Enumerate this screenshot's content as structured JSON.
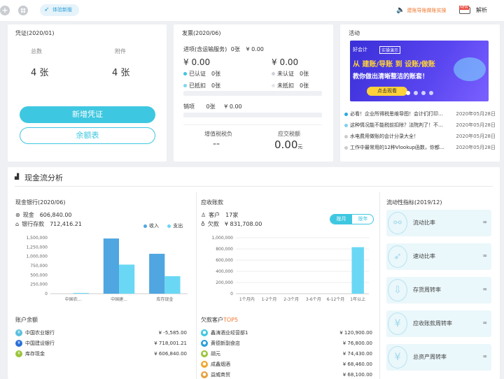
{
  "topbar": {
    "plus_icon": "+",
    "apps_icon": "grid",
    "tab_label": "体验新版",
    "promo_label": "建账导账做账实操",
    "promo_badge": "NEW",
    "analysis_label": "解析"
  },
  "voucher": {
    "title": "凭证(2020/01)",
    "total_label": "总数",
    "attach_label": "附件",
    "total_value": "4 张",
    "attach_value": "4 张",
    "new_btn": "新增凭证",
    "balance_btn": "余额表"
  },
  "invoice": {
    "title": "发票(2020/06)",
    "input_label": "进项(含运输服务)",
    "input_count": "0张",
    "input_amount": "¥ 0.00",
    "left_amount": "¥ 0.00",
    "right_amount": "¥ 0.00",
    "certified": "已认证",
    "certified_count": "0张",
    "uncertified": "未认证",
    "uncertified_count": "0张",
    "deducted": "已抵扣",
    "deducted_count": "0张",
    "undeducted": "未抵扣",
    "undeducted_count": "0张",
    "output_label": "销项",
    "output_count": "0张",
    "output_amount": "¥ 0.00",
    "vat_label": "增值税税负",
    "vat_value": "--",
    "tax_label": "应交税额",
    "tax_value": "0.00",
    "tax_unit": "元"
  },
  "activity": {
    "title": "活动",
    "banner_logo": "好会计",
    "banner_tag": "实操演示",
    "banner_line1": "从 建账/导账 到 设账/做账",
    "banner_line2": "教你做出清晰整洁的账套！",
    "banner_btn": "点击观看",
    "news": [
      {
        "title": "必看！企业所得税思维导图！会计们打印…",
        "date": "2020年05月28日",
        "color": "#2aa7e0"
      },
      {
        "title": "这种情况能不能税前扣除？法院判了！不…",
        "date": "2020年05月28日",
        "color": "#7fd0f0"
      },
      {
        "title": "水电费用做账的会计分录大全！",
        "date": "2020年05月28日",
        "color": "#cccccc"
      },
      {
        "title": "工作中最常用的12种Vlookup函数，你都…",
        "date": "2020年05月28日",
        "color": "#cccccc"
      }
    ]
  },
  "cashflow": {
    "title": "现金流分析",
    "bank_title": "现金银行(2020/06)",
    "cash_label": "现金",
    "cash_value": "606,840.00",
    "bank_label": "银行存款",
    "bank_value": "712,416.21",
    "legend_in": "收入",
    "legend_out": "支出",
    "balance_title": "账户余额",
    "balances": [
      {
        "name": "中国农业银行",
        "amount": "¥ -5,585.00",
        "color": "#5bc0de"
      },
      {
        "name": "中国建设银行",
        "amount": "¥ 718,001.21",
        "color": "#2a6fd8"
      },
      {
        "name": "库存现金",
        "amount": "¥ 606,840.00",
        "color": "#9bc53d"
      }
    ],
    "ar_title": "应收账款",
    "customer_label": "客户",
    "customer_value": "17家",
    "debt_label": "欠款",
    "debt_value": "¥ 831,708.00",
    "toggle_month": "按月",
    "toggle_year": "按年",
    "top_title": "欠款客户",
    "top_title_tag": "TOP5",
    "top5": [
      {
        "name": "鑫涛酒业经营部1",
        "amount": "¥ 120,900.00",
        "color": "#3ec7e0"
      },
      {
        "name": "黄德新副食店",
        "amount": "¥ 76,800.00",
        "color": "#2a9fd8"
      },
      {
        "name": "胡元",
        "amount": "¥ 74,430.00",
        "color": "#9bc53d"
      },
      {
        "name": "成鑫烟酒",
        "amount": "¥ 68,460.00",
        "color": "#f0a830"
      },
      {
        "name": "益威商贸",
        "amount": "¥ 68,100.00",
        "color": "#e8a040"
      }
    ],
    "liq_title": "流动性指标(2019/12)",
    "kpis": [
      {
        "label": "流动比率",
        "value": "∞",
        "icon": "share-icon"
      },
      {
        "label": "速动比率",
        "value": "∞",
        "icon": "rocket-icon"
      },
      {
        "label": "存货周转率",
        "value": "∞",
        "icon": "inbox-icon"
      },
      {
        "label": "应收账款周转率",
        "value": "∞",
        "icon": "yen-circle-icon"
      },
      {
        "label": "总资产周转率",
        "value": "∞",
        "icon": "yen-card-icon"
      }
    ]
  },
  "chart_data": [
    {
      "type": "bar",
      "categories": [
        "中国农...",
        "中国建...",
        "库存现金"
      ],
      "series": [
        {
          "name": "收入",
          "values": [
            0,
            1480000,
            1070000
          ],
          "color": "#4fa6e0"
        },
        {
          "name": "支出",
          "values": [
            20000,
            780000,
            470000
          ],
          "color": "#6ad8f5"
        }
      ],
      "ylim": [
        0,
        1500000
      ],
      "yticks": [
        "0",
        "250,000",
        "500,000",
        "750,000",
        "1,000,000",
        "1,250,000",
        "1,500,000"
      ],
      "grid": false
    },
    {
      "type": "bar",
      "categories": [
        "1个月内",
        "1-2个月",
        "2-3个月",
        "3-6个月",
        "6-12个月",
        "1年以上"
      ],
      "values": [
        0,
        0,
        0,
        0,
        0,
        831708
      ],
      "color": "#6ad8f5",
      "ylim": [
        0,
        1000000
      ],
      "yticks": [
        "0",
        "200,000",
        "400,000",
        "600,000",
        "800,000",
        "1,000,000"
      ],
      "grid": true
    }
  ]
}
